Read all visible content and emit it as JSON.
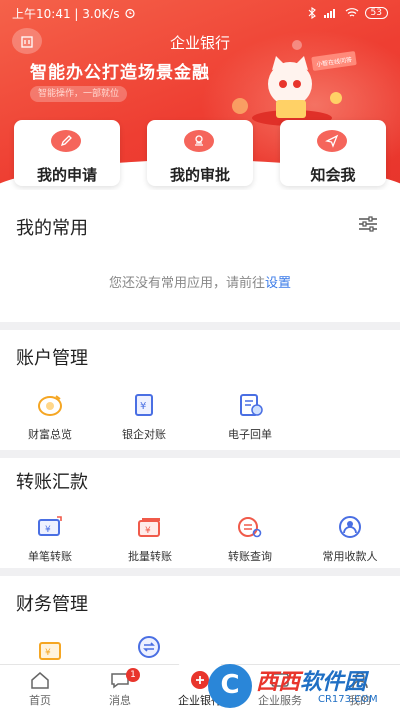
{
  "status_bar": {
    "time_speed": "上午10:41 | 3.0K/s",
    "battery": "53"
  },
  "header": {
    "title": "企业银行",
    "slogan": "智能办公打造场景金融",
    "sub_slogan": "智能操作，一部就位",
    "mascot_tag": "小智在线问答"
  },
  "quick_actions": [
    {
      "label": "我的申请",
      "icon": "pen-icon"
    },
    {
      "label": "我的审批",
      "icon": "stamp-icon"
    },
    {
      "label": "知会我",
      "icon": "send-icon"
    }
  ],
  "favorites": {
    "title": "我的常用",
    "empty_text": "您还没有常用应用，请前往",
    "settings_link": "设置"
  },
  "account_mgmt": {
    "title": "账户管理",
    "items": [
      {
        "label": "财富总览",
        "icon": "wealth-icon"
      },
      {
        "label": "银企对账",
        "icon": "reconcile-icon"
      },
      {
        "label": "电子回单",
        "icon": "receipt-icon"
      }
    ]
  },
  "transfer": {
    "title": "转账汇款",
    "items": [
      {
        "label": "单笔转账",
        "icon": "single-transfer-icon"
      },
      {
        "label": "批量转账",
        "icon": "batch-transfer-icon"
      },
      {
        "label": "转账查询",
        "icon": "transfer-query-icon"
      },
      {
        "label": "常用收款人",
        "icon": "payee-icon"
      }
    ]
  },
  "finance_mgmt": {
    "title": "财务管理"
  },
  "tabbar": {
    "items": [
      {
        "label": "首页",
        "icon": "home-icon"
      },
      {
        "label": "消息",
        "icon": "message-icon",
        "badge": "1"
      },
      {
        "label": "企业银行",
        "icon": "bank-icon"
      },
      {
        "label": "企业服务",
        "icon": "service-icon"
      },
      {
        "label": "我的",
        "icon": "user-icon"
      }
    ]
  },
  "watermark": {
    "main_a": "西西",
    "main_b": "软件园",
    "sub": "CR173.COM"
  },
  "colors": {
    "brand": "#ee3e32",
    "link": "#3b7be8",
    "icon_orange": "#f5a623",
    "icon_blue": "#4a6fe3",
    "icon_red": "#f05a4a"
  }
}
